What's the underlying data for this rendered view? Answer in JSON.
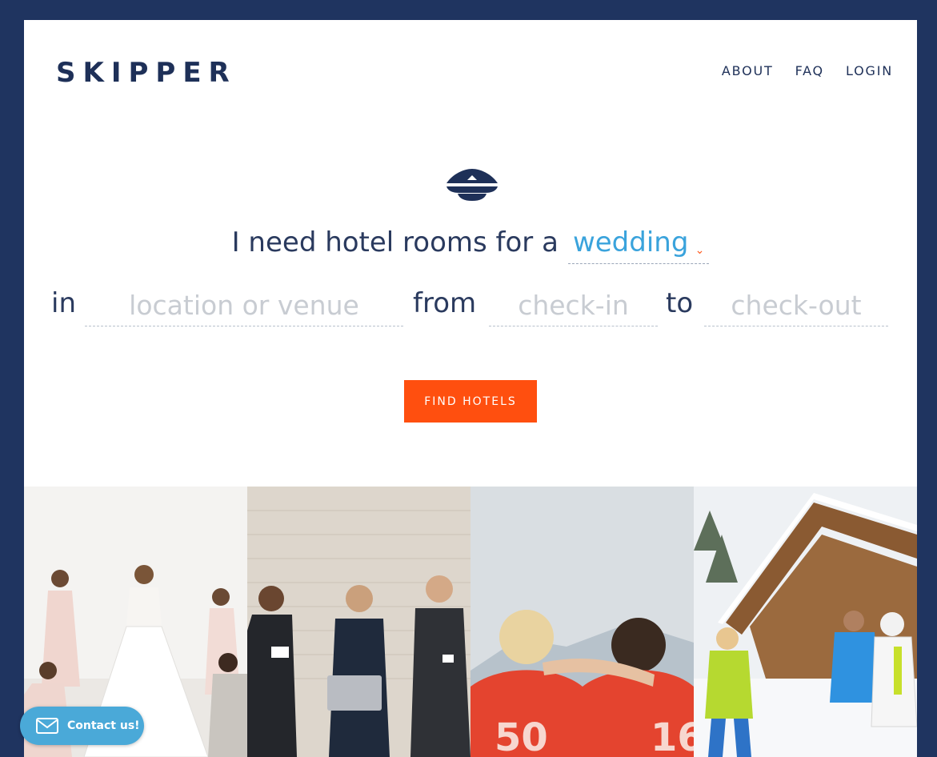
{
  "brand": {
    "logo": "SKIPPER"
  },
  "nav": {
    "items": [
      "ABOUT",
      "FAQ",
      "LOGIN"
    ]
  },
  "search": {
    "lead": "I need hotel rooms for a",
    "event_type": "wedding",
    "in_word": "in",
    "location_placeholder": "location or venue",
    "from_word": "from",
    "checkin_placeholder": "check-in",
    "to_word": "to",
    "checkout_placeholder": "check-out",
    "submit_label": "FIND HOTELS"
  },
  "photos": [
    {
      "icon": "wedding-party-photo"
    },
    {
      "icon": "business-meeting-photo"
    },
    {
      "icon": "sports-team-photo"
    },
    {
      "icon": "ski-lodge-photo"
    }
  ],
  "contact": {
    "label": "Contact us!",
    "icon": "envelope-icon"
  },
  "colors": {
    "frame": "#1f3460",
    "brand_navy": "#1e3058",
    "accent_blue": "#3aa3dc",
    "cta_orange": "#ff4f0f",
    "contact_blue": "#4aa9d8"
  }
}
